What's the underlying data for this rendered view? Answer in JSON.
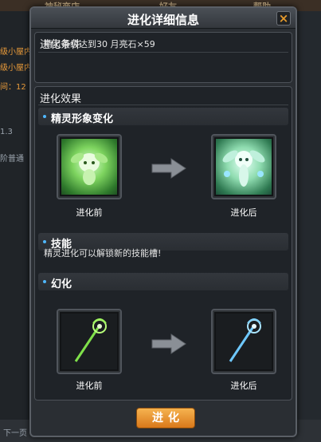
{
  "background": {
    "tabs": [
      "神秘商店",
      "好友",
      "帮助"
    ],
    "left_texts": [
      "级小屋内",
      "级小屋内",
      "间：12",
      "1.3",
      "阶普通"
    ],
    "bottom_text": "下一页"
  },
  "dialog": {
    "title": "进化详细信息",
    "close_icon": "×",
    "conditions": {
      "heading": "进化条件",
      "text": "精灵等级达到30    月亮石×59"
    },
    "effects": {
      "heading": "进化效果",
      "appearance": {
        "label": "精灵形象变化",
        "before_label": "进化前",
        "after_label": "进化后"
      },
      "skill": {
        "label": "技能",
        "text": "精灵进化可以解锁新的技能槽!"
      },
      "transform": {
        "label": "幻化",
        "before_label": "进化前",
        "after_label": "进化后"
      }
    },
    "evolve_button": "进化"
  },
  "colors": {
    "accent_orange": "#e59a2c",
    "dot_blue": "#4fb8ff"
  }
}
